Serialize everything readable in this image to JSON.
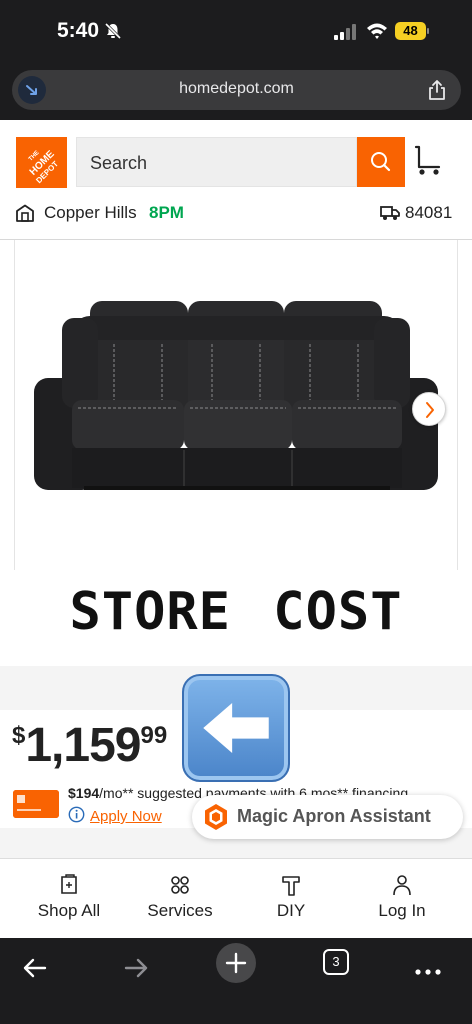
{
  "status_bar": {
    "time": "5:40",
    "battery": "48"
  },
  "browser": {
    "url": "homedepot.com",
    "tab_count": "3"
  },
  "header": {
    "logo_text": "THE HOME DEPOT",
    "search_placeholder": "Search",
    "store_name": "Copper Hills",
    "store_hours": "8PM",
    "zip": "84081"
  },
  "overlay": {
    "text": "STORE COST"
  },
  "price": {
    "dollar_sign": "$",
    "main": "1,159",
    "cents": "99",
    "finance_amount": "$194",
    "finance_rest": "/mo** suggested payments with 6 mos** financing",
    "apply_now": "Apply Now"
  },
  "assistant": {
    "label": "Magic Apron Assistant"
  },
  "app_nav": {
    "items": [
      {
        "label": "Shop All",
        "icon": "shop-all-icon"
      },
      {
        "label": "Services",
        "icon": "services-icon"
      },
      {
        "label": "DIY",
        "icon": "diy-hammer-icon"
      },
      {
        "label": "Log In",
        "icon": "person-icon"
      }
    ]
  },
  "colors": {
    "brand_orange": "#f96302",
    "store_hours_green": "#00a650",
    "status_bar_bg": "#1c1c1e",
    "battery_yellow": "#f5cf23"
  }
}
